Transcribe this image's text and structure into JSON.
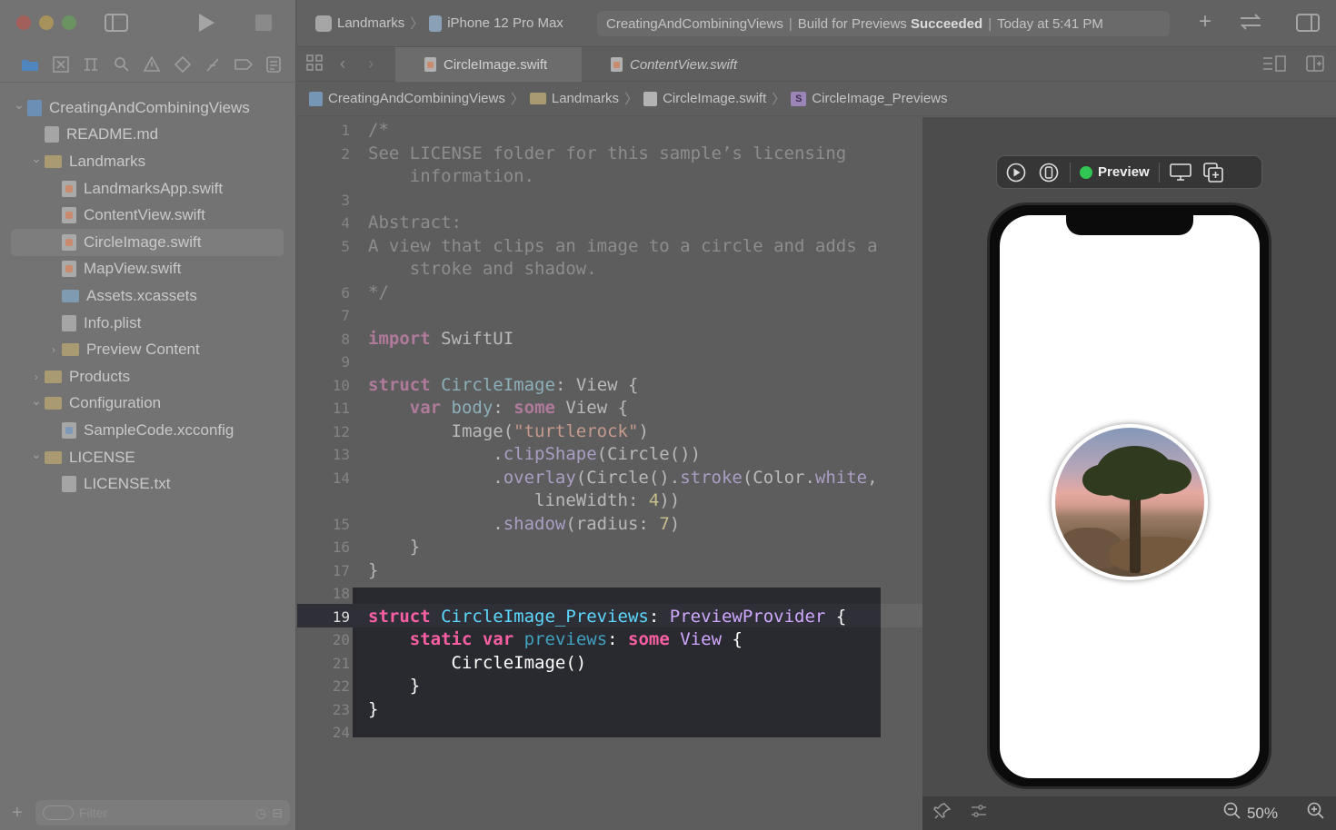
{
  "window": {
    "scheme": "Landmarks",
    "device": "iPhone 12 Pro Max",
    "status": {
      "project": "CreatingAndCombiningViews",
      "action": "Build for Previews",
      "result": "Succeeded",
      "time": "Today at 5:41 PM"
    }
  },
  "navigator": {
    "filter_placeholder": "Filter",
    "items": [
      {
        "label": "CreatingAndCombiningViews",
        "indent": 0,
        "icon": "project-icon",
        "chevron": "down"
      },
      {
        "label": "README.md",
        "indent": 1,
        "icon": "doc-icon",
        "chevron": ""
      },
      {
        "label": "Landmarks",
        "indent": 1,
        "icon": "folder-icon",
        "chevron": "down"
      },
      {
        "label": "LandmarksApp.swift",
        "indent": 2,
        "icon": "swift-file-icon",
        "chevron": ""
      },
      {
        "label": "ContentView.swift",
        "indent": 2,
        "icon": "swift-file-icon",
        "chevron": ""
      },
      {
        "label": "CircleImage.swift",
        "indent": 2,
        "icon": "swift-file-icon",
        "chevron": "",
        "selected": true
      },
      {
        "label": "MapView.swift",
        "indent": 2,
        "icon": "swift-file-icon",
        "chevron": ""
      },
      {
        "label": "Assets.xcassets",
        "indent": 2,
        "icon": "assets-icon",
        "chevron": ""
      },
      {
        "label": "Info.plist",
        "indent": 2,
        "icon": "doc-icon",
        "chevron": ""
      },
      {
        "label": "Preview Content",
        "indent": 2,
        "icon": "folder-icon",
        "chevron": "right"
      },
      {
        "label": "Products",
        "indent": 1,
        "icon": "folder-icon",
        "chevron": "right"
      },
      {
        "label": "Configuration",
        "indent": 1,
        "icon": "folder-icon",
        "chevron": "down"
      },
      {
        "label": "SampleCode.xcconfig",
        "indent": 2,
        "icon": "config-file-icon",
        "chevron": ""
      },
      {
        "label": "LICENSE",
        "indent": 1,
        "icon": "folder-icon",
        "chevron": "down"
      },
      {
        "label": "LICENSE.txt",
        "indent": 2,
        "icon": "doc-icon",
        "chevron": ""
      }
    ]
  },
  "tabs": [
    {
      "label": "CircleImage.swift",
      "active": true
    },
    {
      "label": "ContentView.swift",
      "active": false
    }
  ],
  "breadcrumb": [
    "CreatingAndCombiningViews",
    "Landmarks",
    "CircleImage.swift",
    "CircleImage_Previews"
  ],
  "editor": {
    "current_line": 19,
    "lines": [
      {
        "n": "1",
        "html": "<span class='c-cm'>/*</span>"
      },
      {
        "n": "2",
        "html": "<span class='c-cm'>See LICENSE folder for this sample’s licensing</span>"
      },
      {
        "n": "",
        "html": "<span class='c-cm'>    information.</span>"
      },
      {
        "n": "3",
        "html": ""
      },
      {
        "n": "4",
        "html": "<span class='c-cm'>Abstract:</span>"
      },
      {
        "n": "5",
        "html": "<span class='c-cm'>A view that clips an image to a circle and adds a</span>"
      },
      {
        "n": "",
        "html": "<span class='c-cm'>    stroke and shadow.</span>"
      },
      {
        "n": "6",
        "html": "<span class='c-cm'>*/</span>"
      },
      {
        "n": "7",
        "html": ""
      },
      {
        "n": "8",
        "html": "<span class='kw-d'>import</span> SwiftUI"
      },
      {
        "n": "9",
        "html": ""
      },
      {
        "n": "10",
        "html": "<span class='kw-d'>struct</span> <span class='ty-d'>CircleImage</span>: View {"
      },
      {
        "n": "11",
        "html": "    <span class='kw-d'>var</span> <span class='ty-d'>body</span>: <span class='kw-d'>some</span> View {"
      },
      {
        "n": "12",
        "html": "        Image(<span class='st-d'>\"turtlerock\"</span>)"
      },
      {
        "n": "13",
        "html": "            .<span class='fn-d'>clipShape</span>(Circle())"
      },
      {
        "n": "14",
        "html": "            .<span class='fn-d'>overlay</span>(Circle().<span class='fn-d'>stroke</span>(Color.<span class='fn-d'>white</span>,"
      },
      {
        "n": "",
        "html": "                lineWidth: <span class='nm-d'>4</span>))"
      },
      {
        "n": "15",
        "html": "            .<span class='fn-d'>shadow</span>(radius: <span class='nm-d'>7</span>)"
      },
      {
        "n": "16",
        "html": "    }"
      },
      {
        "n": "17",
        "html": "}"
      },
      {
        "n": "18",
        "html": ""
      },
      {
        "n": "19",
        "html": "<span class='kw'>struct</span> <span class='ty'>CircleImage_Previews</span><span class='pl'>: </span><span class='ty2'>PreviewProvider</span><span class='pl'> {</span>"
      },
      {
        "n": "20",
        "html": "    <span class='kw'>static</span> <span class='kw'>var</span> <span class='id'>previews</span><span class='pl'>: </span><span class='kw'>some</span> <span class='ty2'>View</span><span class='pl'> {</span>"
      },
      {
        "n": "21",
        "html": "<span class='pl'>        CircleImage()</span>"
      },
      {
        "n": "22",
        "html": "<span class='pl'>    }</span>"
      },
      {
        "n": "23",
        "html": "<span class='pl'>}</span>"
      },
      {
        "n": "24",
        "html": ""
      }
    ]
  },
  "preview": {
    "label": "Preview",
    "status_color": "#31c553",
    "zoom": "50%"
  }
}
